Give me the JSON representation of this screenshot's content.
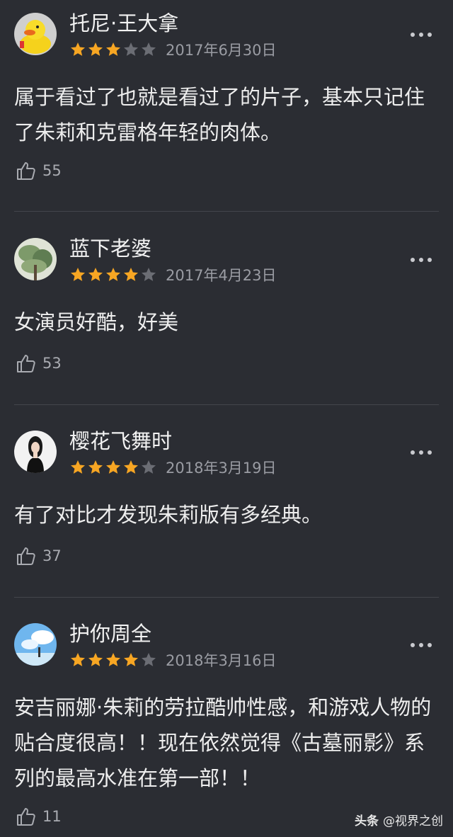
{
  "reviews": [
    {
      "user": "托尼·王大拿",
      "stars": 3,
      "date": "2017年6月30日",
      "text": "属于看过了也就是看过了的片子，基本只记住了朱莉和克雷格年轻的肉体。",
      "likes": "55",
      "avatar": "duck-toy-icon"
    },
    {
      "user": "蓝下老婆",
      "stars": 4,
      "date": "2017年4月23日",
      "text": "女演员好酷，好美",
      "likes": "53",
      "avatar": "tree-photo-icon"
    },
    {
      "user": "樱花飞舞时",
      "stars": 4,
      "date": "2018年3月19日",
      "text": "有了对比才发现朱莉版有多经典。",
      "likes": "37",
      "avatar": "woman-portrait-icon"
    },
    {
      "user": "护你周全",
      "stars": 4,
      "date": "2018年3月16日",
      "text": "安吉丽娜·朱莉的劳拉酷帅性感，和游戏人物的贴合度很高！！现在依然觉得《古墓丽影》系列的最高水准在第一部！！",
      "likes": "11",
      "avatar": "anime-sky-icon"
    }
  ],
  "star_max": 5,
  "colors": {
    "star_on": "#f7a623",
    "star_off": "#6b6d74",
    "background": "#2b2d33"
  },
  "watermark": {
    "brand": "头条",
    "handle": "@视界之创"
  }
}
